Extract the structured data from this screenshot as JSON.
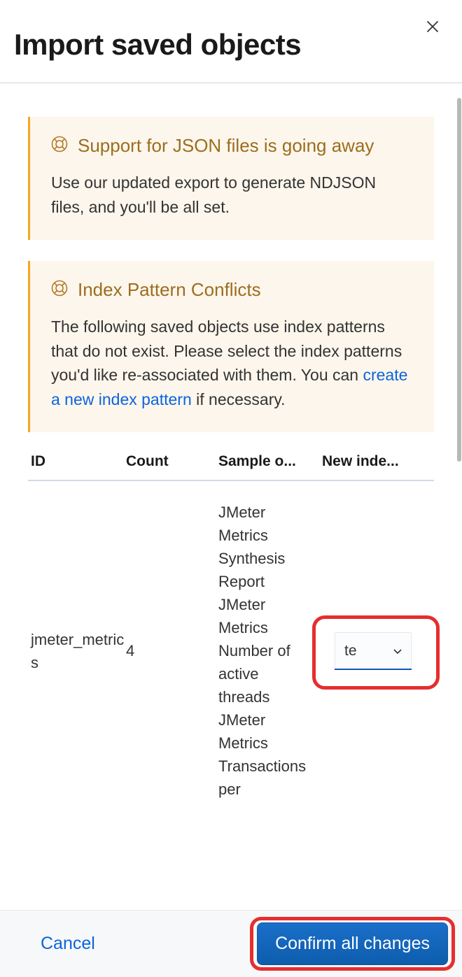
{
  "header": {
    "title": "Import saved objects"
  },
  "callouts": [
    {
      "title": "Support for JSON files is going away",
      "body": "Use our updated export to generate NDJSON files, and you'll be all set."
    },
    {
      "title": "Index Pattern Conflicts",
      "body_pre": "The following saved objects use index patterns that do not exist. Please select the index patterns you'd like re-associated with them. You can ",
      "link": "create a new index pattern",
      "body_post": " if necessary."
    }
  ],
  "table": {
    "headers": {
      "id": "ID",
      "count": "Count",
      "sample": "Sample o...",
      "new_index": "New inde..."
    },
    "rows": [
      {
        "id": "jmeter_metrics",
        "count": "4",
        "sample": "JMeter Metrics Synthesis Report\nJMeter Metrics Number of active threads\nJMeter Metrics Transactions per",
        "select_value": "te"
      }
    ]
  },
  "footer": {
    "cancel": "Cancel",
    "confirm": "Confirm all changes"
  }
}
